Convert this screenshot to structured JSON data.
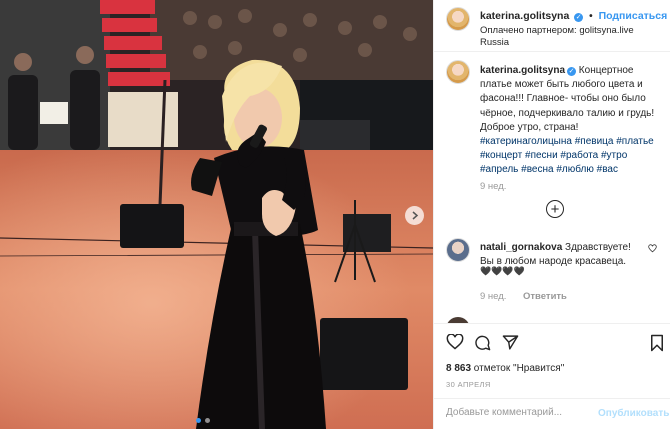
{
  "post": {
    "header": {
      "username": "katerina.golitsyna",
      "separator": "•",
      "follow_label": "Подписаться",
      "partner_prefix": "Оплачено партнером: ",
      "partner_name": "golitsyna.live",
      "location": "Russia"
    },
    "caption": {
      "author": "katerina.golitsyna",
      "text": " Концертное платье может быть любого цвета и фасона!!! Главное- чтобы оно было чёрное, подчеркивало талию и грудь! Доброе утро, страна! ",
      "hashtags": "#катеринаголицына #певица #платье #концерт #песни #работа #утро #апрель #весна #люблю #вас",
      "time": "9 нед."
    },
    "comments": [
      {
        "author": "natali_gornakova",
        "text": " Здравствуете! Вы в любом народе красавеца.",
        "emoji": "🖤🖤🖤🖤",
        "time": "9 нед.",
        "reply_label": "Ответить"
      }
    ],
    "likes_count": "8 863",
    "likes_label": " отметок \"Нравится\"",
    "date": "30 АПРЕЛЯ",
    "comment_placeholder": "Добавьте комментарий...",
    "publish_label": "Опубликовать",
    "colors": {
      "accent": "#3897f0",
      "stage_floor": "#d9785a",
      "dress": "#0d0b0c",
      "hair": "#f3dd9a"
    },
    "icons": [
      "verified-icon",
      "plus-circle-icon",
      "heart-icon",
      "comment-icon",
      "share-icon",
      "bookmark-icon",
      "chevron-right-icon"
    ]
  }
}
